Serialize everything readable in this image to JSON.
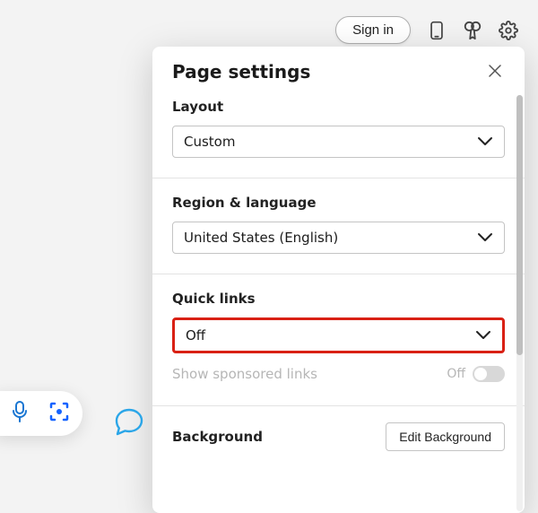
{
  "toolbar": {
    "sign_in": "Sign in"
  },
  "panel": {
    "title": "Page settings",
    "sections": {
      "layout": {
        "label": "Layout",
        "value": "Custom"
      },
      "region": {
        "label": "Region & language",
        "value": "United States (English)"
      },
      "quicklinks": {
        "label": "Quick links",
        "value": "Off",
        "sponsored_label": "Show sponsored links",
        "sponsored_state": "Off"
      },
      "background": {
        "label": "Background",
        "button": "Edit Background"
      }
    }
  }
}
